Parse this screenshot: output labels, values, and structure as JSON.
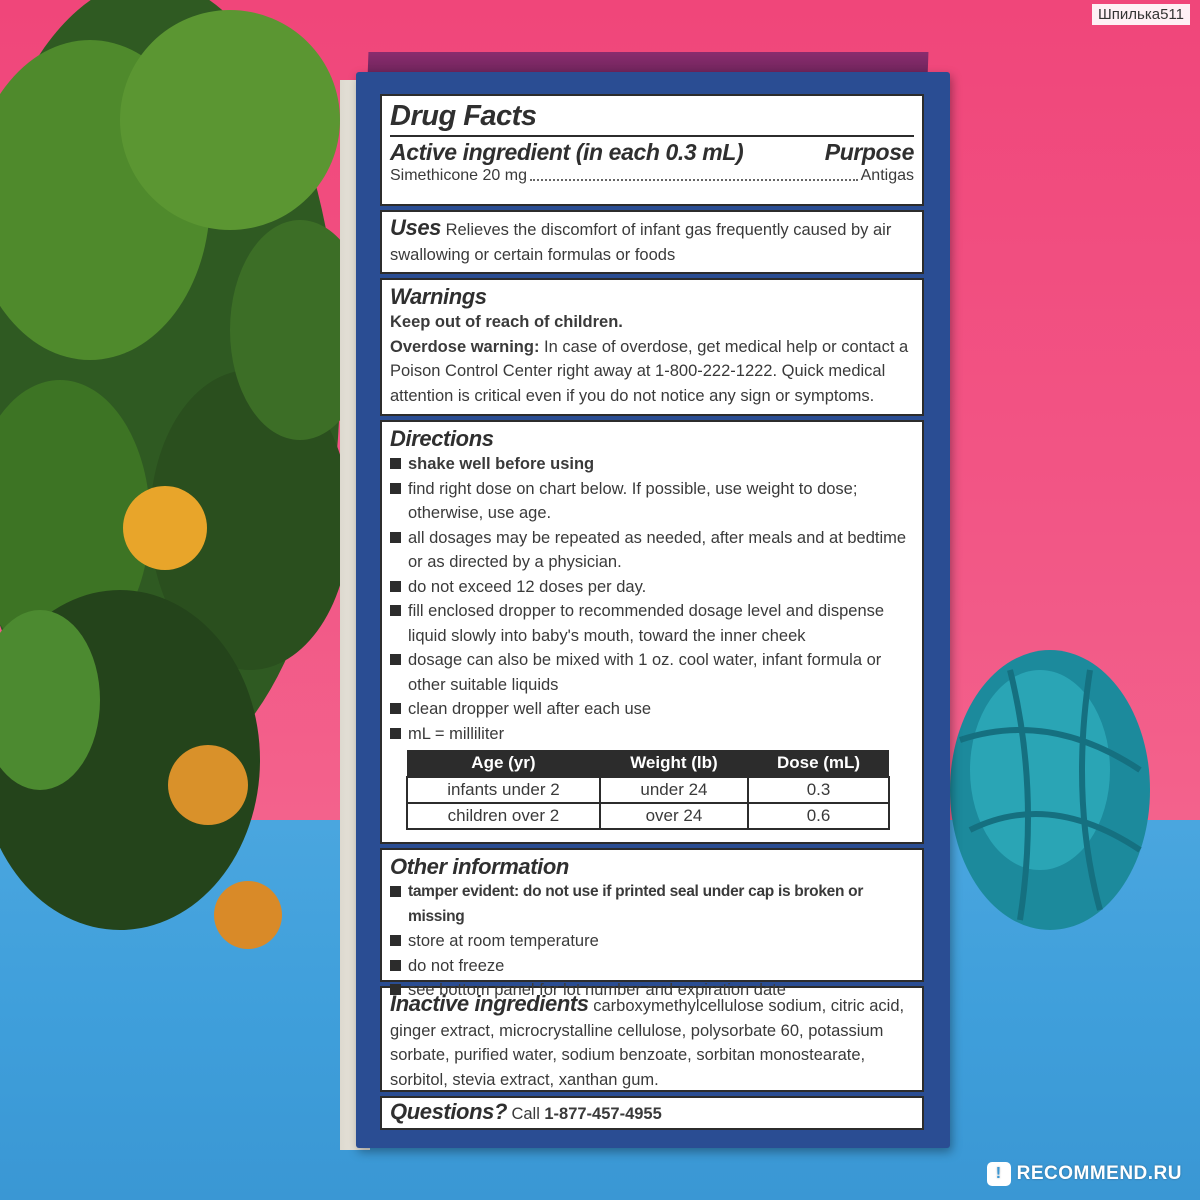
{
  "watermark_top": "Шпилька511",
  "watermark_bottom": "RECOMMEND.RU",
  "title": "Drug Facts",
  "active": {
    "heading": "Active ingredient (in each 0.3 mL)",
    "purpose_heading": "Purpose",
    "ingredient": "Simethicone 20 mg",
    "purpose": "Antigas"
  },
  "uses": {
    "heading": "Uses",
    "text": "Relieves the discomfort of infant gas frequently caused by air swallowing or certain formulas or foods"
  },
  "warnings": {
    "heading": "Warnings",
    "keep_out": "Keep out of reach of children.",
    "overdose_label": "Overdose warning:",
    "overdose_text": "In case of overdose, get medical help or contact a Poison Control Center right away at 1-800-222-1222. Quick medical attention is critical even if you do not notice any sign or symptoms."
  },
  "directions": {
    "heading": "Directions",
    "items": [
      "shake well before using",
      "find right dose on chart below. If possible, use weight to dose; otherwise, use age.",
      "all dosages may be repeated as needed, after meals and at bedtime or as directed by a physician.",
      "do not exceed 12 doses per day.",
      "fill enclosed dropper to recommended dosage level and dispense liquid slowly into baby's mouth, toward the inner cheek",
      "dosage can also be mixed with 1 oz. cool water, infant formula or other suitable liquids",
      "clean dropper well after each use",
      "mL = milliliter"
    ],
    "table": {
      "headers": [
        "Age (yr)",
        "Weight (lb)",
        "Dose (mL)"
      ],
      "rows": [
        [
          "infants under 2",
          "under 24",
          "0.3"
        ],
        [
          "children over 2",
          "over 24",
          "0.6"
        ]
      ]
    }
  },
  "other": {
    "heading": "Other information",
    "items": [
      "tamper evident: do not use if printed seal under cap is broken or missing",
      "store at room temperature",
      "do not freeze",
      "see bottom panel for lot number and expiration date"
    ]
  },
  "inactive": {
    "heading": "Inactive ingredients",
    "text": "carboxymethylcellulose sodium, citric acid, ginger extract, microcrystalline cellulose, polysorbate 60, potassium sorbate, purified water, sodium benzoate, sorbitan monostearate, sorbitol, stevia extract, xanthan gum."
  },
  "questions": {
    "heading": "Questions?",
    "call": "Call",
    "phone": "1-877-457-4955"
  }
}
